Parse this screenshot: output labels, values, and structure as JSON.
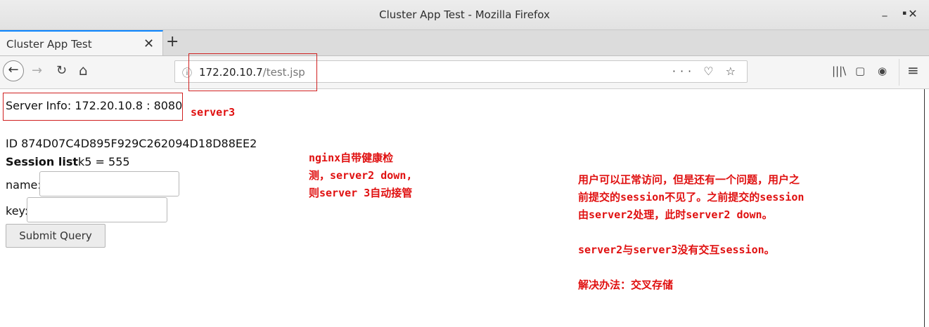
{
  "window": {
    "title": "Cluster App Test - Mozilla Firefox",
    "min_symbol": "_",
    "max_symbol": "▪",
    "close_symbol": "✕"
  },
  "tabs": [
    {
      "label": "Cluster App Test",
      "close_symbol": "✕"
    }
  ],
  "newtab_symbol": "+",
  "nav": {
    "back_symbol": "←",
    "forward_symbol": "→",
    "reload_symbol": "↻",
    "home_symbol": "⌂",
    "info_symbol": "ⓘ",
    "url_host": "172.20.10.7",
    "url_path": "/test.jsp",
    "actions": "··· ♡ ☆",
    "library_symbol": "|||\\",
    "sidebar_symbol": "▢",
    "account_symbol": "◉",
    "menu_symbol": "≡"
  },
  "page": {
    "server_info": "Server Info: 172.20.10.8 : 8080",
    "id_line": "ID 874D07C4D895F929C262094D18D88EE2",
    "session_list_label": "Session list",
    "session_list_value": "k5 = 555",
    "name_label": "name:",
    "name_value": "",
    "key_label": "key:",
    "key_value": "",
    "submit_label": "Submit Query"
  },
  "annotations": {
    "server3": "server3",
    "nginx_note": "nginx自带健康检\n测，server2 down,\n则server 3自动接管",
    "session_note": "用户可以正常访问，但是还有一个问题，用户之\n前提交的session不见了。之前提交的session\n由server2处理，此时server2 down。\n\nserver2与server3没有交互session。\n\n解决办法：交叉存储"
  },
  "colors": {
    "annotation_red": "#e01010",
    "tab_accent": "#0a84ff"
  }
}
